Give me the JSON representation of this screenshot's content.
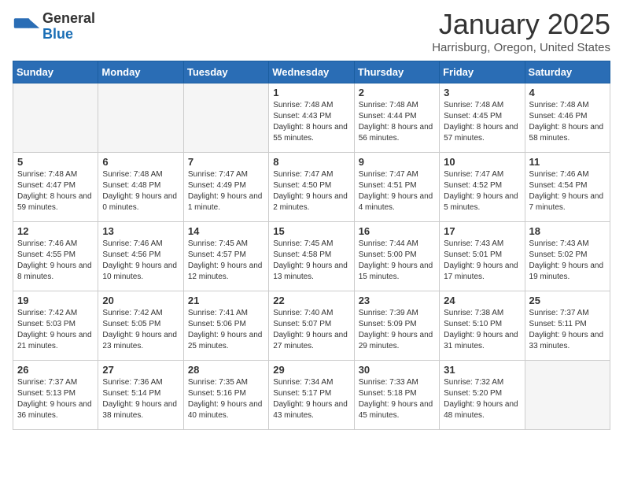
{
  "header": {
    "logo_general": "General",
    "logo_blue": "Blue",
    "title": "January 2025",
    "subtitle": "Harrisburg, Oregon, United States"
  },
  "weekdays": [
    "Sunday",
    "Monday",
    "Tuesday",
    "Wednesday",
    "Thursday",
    "Friday",
    "Saturday"
  ],
  "weeks": [
    [
      {
        "day": null
      },
      {
        "day": null
      },
      {
        "day": null
      },
      {
        "day": 1,
        "sunrise": "7:48 AM",
        "sunset": "4:43 PM",
        "daylight": "8 hours and 55 minutes."
      },
      {
        "day": 2,
        "sunrise": "7:48 AM",
        "sunset": "4:44 PM",
        "daylight": "8 hours and 56 minutes."
      },
      {
        "day": 3,
        "sunrise": "7:48 AM",
        "sunset": "4:45 PM",
        "daylight": "8 hours and 57 minutes."
      },
      {
        "day": 4,
        "sunrise": "7:48 AM",
        "sunset": "4:46 PM",
        "daylight": "8 hours and 58 minutes."
      }
    ],
    [
      {
        "day": 5,
        "sunrise": "7:48 AM",
        "sunset": "4:47 PM",
        "daylight": "8 hours and 59 minutes."
      },
      {
        "day": 6,
        "sunrise": "7:48 AM",
        "sunset": "4:48 PM",
        "daylight": "9 hours and 0 minutes."
      },
      {
        "day": 7,
        "sunrise": "7:47 AM",
        "sunset": "4:49 PM",
        "daylight": "9 hours and 1 minute."
      },
      {
        "day": 8,
        "sunrise": "7:47 AM",
        "sunset": "4:50 PM",
        "daylight": "9 hours and 2 minutes."
      },
      {
        "day": 9,
        "sunrise": "7:47 AM",
        "sunset": "4:51 PM",
        "daylight": "9 hours and 4 minutes."
      },
      {
        "day": 10,
        "sunrise": "7:47 AM",
        "sunset": "4:52 PM",
        "daylight": "9 hours and 5 minutes."
      },
      {
        "day": 11,
        "sunrise": "7:46 AM",
        "sunset": "4:54 PM",
        "daylight": "9 hours and 7 minutes."
      }
    ],
    [
      {
        "day": 12,
        "sunrise": "7:46 AM",
        "sunset": "4:55 PM",
        "daylight": "9 hours and 8 minutes."
      },
      {
        "day": 13,
        "sunrise": "7:46 AM",
        "sunset": "4:56 PM",
        "daylight": "9 hours and 10 minutes."
      },
      {
        "day": 14,
        "sunrise": "7:45 AM",
        "sunset": "4:57 PM",
        "daylight": "9 hours and 12 minutes."
      },
      {
        "day": 15,
        "sunrise": "7:45 AM",
        "sunset": "4:58 PM",
        "daylight": "9 hours and 13 minutes."
      },
      {
        "day": 16,
        "sunrise": "7:44 AM",
        "sunset": "5:00 PM",
        "daylight": "9 hours and 15 minutes."
      },
      {
        "day": 17,
        "sunrise": "7:43 AM",
        "sunset": "5:01 PM",
        "daylight": "9 hours and 17 minutes."
      },
      {
        "day": 18,
        "sunrise": "7:43 AM",
        "sunset": "5:02 PM",
        "daylight": "9 hours and 19 minutes."
      }
    ],
    [
      {
        "day": 19,
        "sunrise": "7:42 AM",
        "sunset": "5:03 PM",
        "daylight": "9 hours and 21 minutes."
      },
      {
        "day": 20,
        "sunrise": "7:42 AM",
        "sunset": "5:05 PM",
        "daylight": "9 hours and 23 minutes."
      },
      {
        "day": 21,
        "sunrise": "7:41 AM",
        "sunset": "5:06 PM",
        "daylight": "9 hours and 25 minutes."
      },
      {
        "day": 22,
        "sunrise": "7:40 AM",
        "sunset": "5:07 PM",
        "daylight": "9 hours and 27 minutes."
      },
      {
        "day": 23,
        "sunrise": "7:39 AM",
        "sunset": "5:09 PM",
        "daylight": "9 hours and 29 minutes."
      },
      {
        "day": 24,
        "sunrise": "7:38 AM",
        "sunset": "5:10 PM",
        "daylight": "9 hours and 31 minutes."
      },
      {
        "day": 25,
        "sunrise": "7:37 AM",
        "sunset": "5:11 PM",
        "daylight": "9 hours and 33 minutes."
      }
    ],
    [
      {
        "day": 26,
        "sunrise": "7:37 AM",
        "sunset": "5:13 PM",
        "daylight": "9 hours and 36 minutes."
      },
      {
        "day": 27,
        "sunrise": "7:36 AM",
        "sunset": "5:14 PM",
        "daylight": "9 hours and 38 minutes."
      },
      {
        "day": 28,
        "sunrise": "7:35 AM",
        "sunset": "5:16 PM",
        "daylight": "9 hours and 40 minutes."
      },
      {
        "day": 29,
        "sunrise": "7:34 AM",
        "sunset": "5:17 PM",
        "daylight": "9 hours and 43 minutes."
      },
      {
        "day": 30,
        "sunrise": "7:33 AM",
        "sunset": "5:18 PM",
        "daylight": "9 hours and 45 minutes."
      },
      {
        "day": 31,
        "sunrise": "7:32 AM",
        "sunset": "5:20 PM",
        "daylight": "9 hours and 48 minutes."
      },
      {
        "day": null
      }
    ]
  ]
}
